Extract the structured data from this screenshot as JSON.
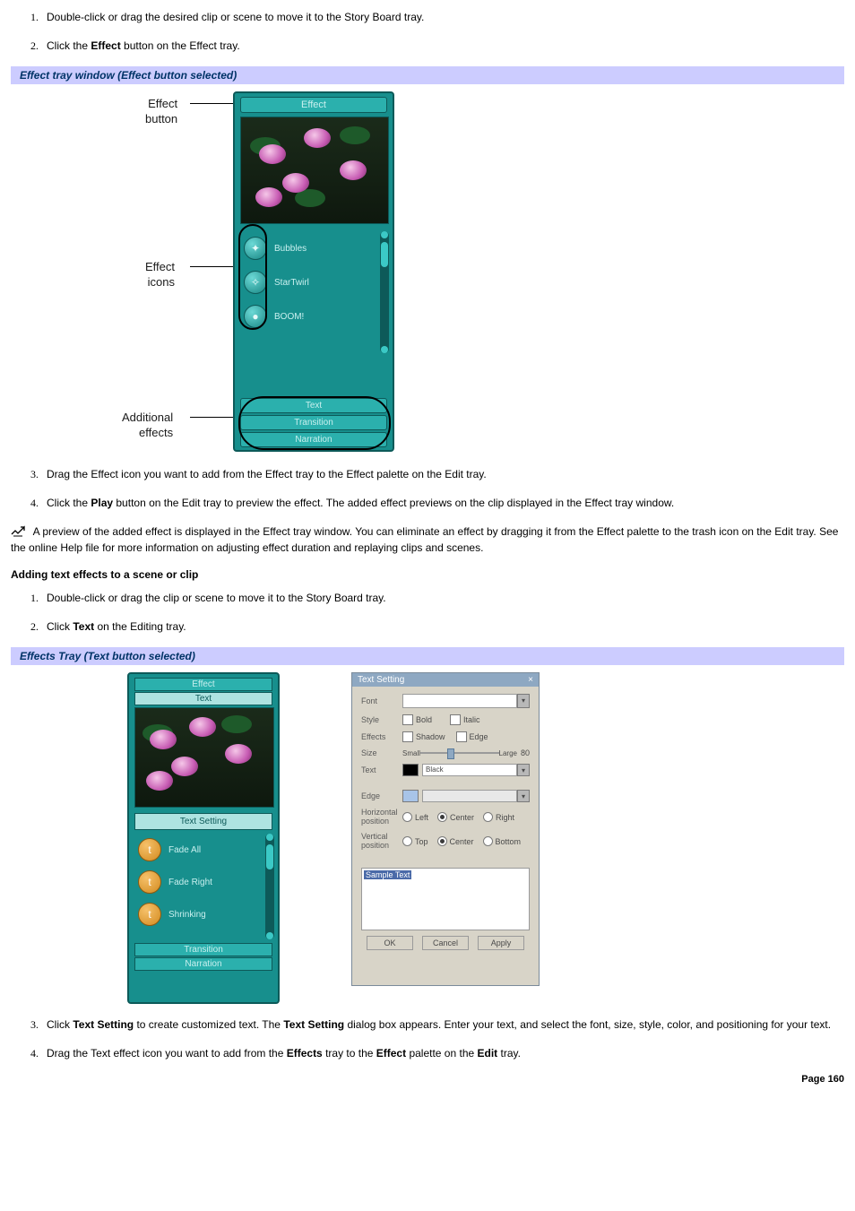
{
  "steps_a": {
    "s1": "Double-click or drag the desired clip or scene to move it to the Story Board tray.",
    "s2_pre": "Click the ",
    "s2_b": "Effect",
    "s2_post": " button on the Effect tray."
  },
  "bar1": "Effect tray window (Effect button selected)",
  "fig1": {
    "callout_btn_l1": "Effect",
    "callout_btn_l2": "button",
    "callout_icons_l1": "Effect",
    "callout_icons_l2": "icons",
    "callout_add_l1": "Additional",
    "callout_add_l2": "effects",
    "tab_effect": "Effect",
    "fx1": "Bubbles",
    "fx2": "StarTwirl",
    "fx3": "BOOM!",
    "tab_text": "Text",
    "tab_trans": "Transition",
    "tab_narr": "Narration"
  },
  "steps_b": {
    "s3": "Drag the Effect icon you want to add from the Effect tray to the Effect palette on the Edit tray.",
    "s4_pre": "Click the ",
    "s4_b": "Play",
    "s4_post": " button on the Edit tray to preview the effect. The added effect previews on the clip displayed in the Effect tray window."
  },
  "note": " A preview of the added effect is displayed in the Effect tray window. You can eliminate an effect by dragging it from the Effect palette to the trash icon on the Edit tray. See the online Help file for more information on adjusting effect duration and replaying clips and scenes.",
  "heading2": "Adding text effects to a scene or clip",
  "steps_c": {
    "s1": "Double-click or drag the clip or scene to move it to the Story Board tray.",
    "s2_pre": "Click ",
    "s2_b": "Text",
    "s2_post": " on the Editing tray."
  },
  "bar2": "Effects Tray (Text button selected)",
  "fig2": {
    "tab_effect": "Effect",
    "tab_text": "Text",
    "text_setting_btn": "Text Setting",
    "fx1": "Fade All",
    "fx2": "Fade Right",
    "fx3": "Shrinking",
    "tab_trans": "Transition",
    "tab_narr": "Narration"
  },
  "dialog": {
    "title": "Text Setting",
    "close": "×",
    "font": "Font",
    "style": "Style",
    "bold": "Bold",
    "italic": "Italic",
    "effects": "Effects",
    "shadow": "Shadow",
    "edge_chk": "Edge",
    "size": "Size",
    "small": "Small",
    "large": "Large",
    "large_val": "80",
    "text": "Text",
    "black": "Black",
    "edge": "Edge",
    "hpos": "Horizontal position",
    "vpos": "Vertical position",
    "left": "Left",
    "center": "Center",
    "right": "Right",
    "top": "Top",
    "bottom": "Bottom",
    "sample": "Sample Text",
    "ok": "OK",
    "cancel": "Cancel",
    "apply": "Apply"
  },
  "steps_d": {
    "s3_pre": "Click ",
    "s3_b1": "Text Setting",
    "s3_mid": " to create customized text. The ",
    "s3_b2": "Text Setting",
    "s3_post": " dialog box appears. Enter your text, and select the font, size, style, color, and positioning for your text.",
    "s4_pre": "Drag the Text effect icon you want to add from the ",
    "s4_b1": "Effects",
    "s4_mid1": " tray to the ",
    "s4_b2": "Effect",
    "s4_mid2": " palette on the ",
    "s4_b3": "Edit",
    "s4_post": " tray."
  },
  "page_num": "Page 160"
}
